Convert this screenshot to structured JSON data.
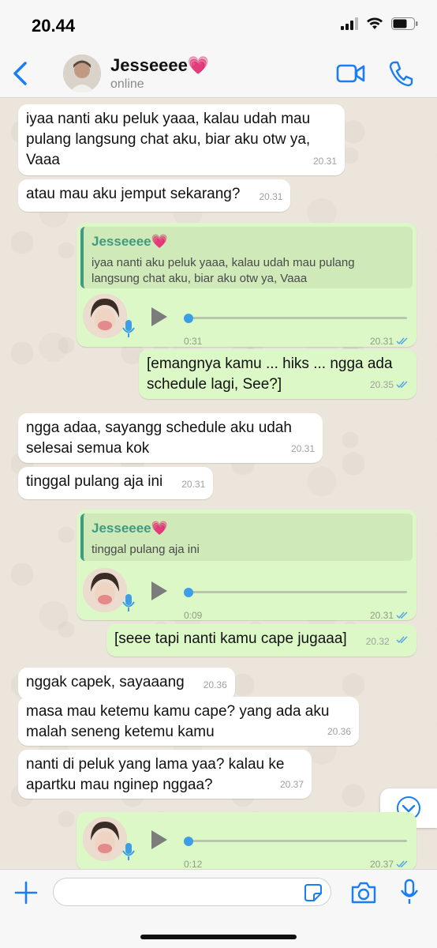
{
  "status_bar": {
    "time": "20.44"
  },
  "header": {
    "contact_name": "Jesseeee💗",
    "presence": "online"
  },
  "messages": [
    {
      "text": "iyaa nanti aku peluk yaaa, kalau udah mau\npulang langsung chat aku, biar aku otw ya,\nVaaa",
      "time": "20.31"
    },
    {
      "text": "atau mau aku jemput sekarang?",
      "time": "20.31"
    },
    {
      "reply_name": "Jesseeee💗",
      "reply_text": "iyaa nanti aku peluk yaaa, kalau udah mau pulang langsung chat aku, biar aku otw ya, Vaaa",
      "duration": "0:31",
      "time": "20.31"
    },
    {
      "text": "[emangnya kamu ... hiks ... ngga ada\nschedule lagi, See?]",
      "time": "20.35"
    },
    {
      "text": "ngga adaa, sayangg schedule aku udah\nselesai semua kok",
      "time": "20.31"
    },
    {
      "text": "tinggal pulang aja ini",
      "time": "20.31"
    },
    {
      "reply_name": "Jesseeee💗",
      "reply_text": "tinggal pulang aja ini",
      "duration": "0:09",
      "time": "20.31"
    },
    {
      "text": "[seee tapi nanti kamu cape jugaaa]",
      "time": "20.32"
    },
    {
      "text": "nggak capek, sayaaang",
      "time": "20.36"
    },
    {
      "text": "masa mau ketemu kamu cape? yang ada aku\nmalah seneng ketemu kamu",
      "time": "20.36"
    },
    {
      "text": "nanti di peluk yang lama yaa? kalau ke\napartku mau nginep nggaa?",
      "time": "20.37"
    },
    {
      "duration": "0:12",
      "time": "20.37"
    }
  ],
  "composer": {
    "placeholder": ""
  },
  "colors": {
    "accent": "#1a7ef2",
    "incoming": "#ffffff",
    "outgoing": "#dcf8c6",
    "quote_name": "#3e9b80",
    "tick": "#4fa3e8"
  },
  "icons": [
    "back-arrow-icon",
    "video-call-icon",
    "phone-icon",
    "play-icon",
    "microphone-icon",
    "double-check-icon",
    "scroll-down-icon",
    "plus-icon",
    "sticker-icon",
    "camera-icon"
  ]
}
